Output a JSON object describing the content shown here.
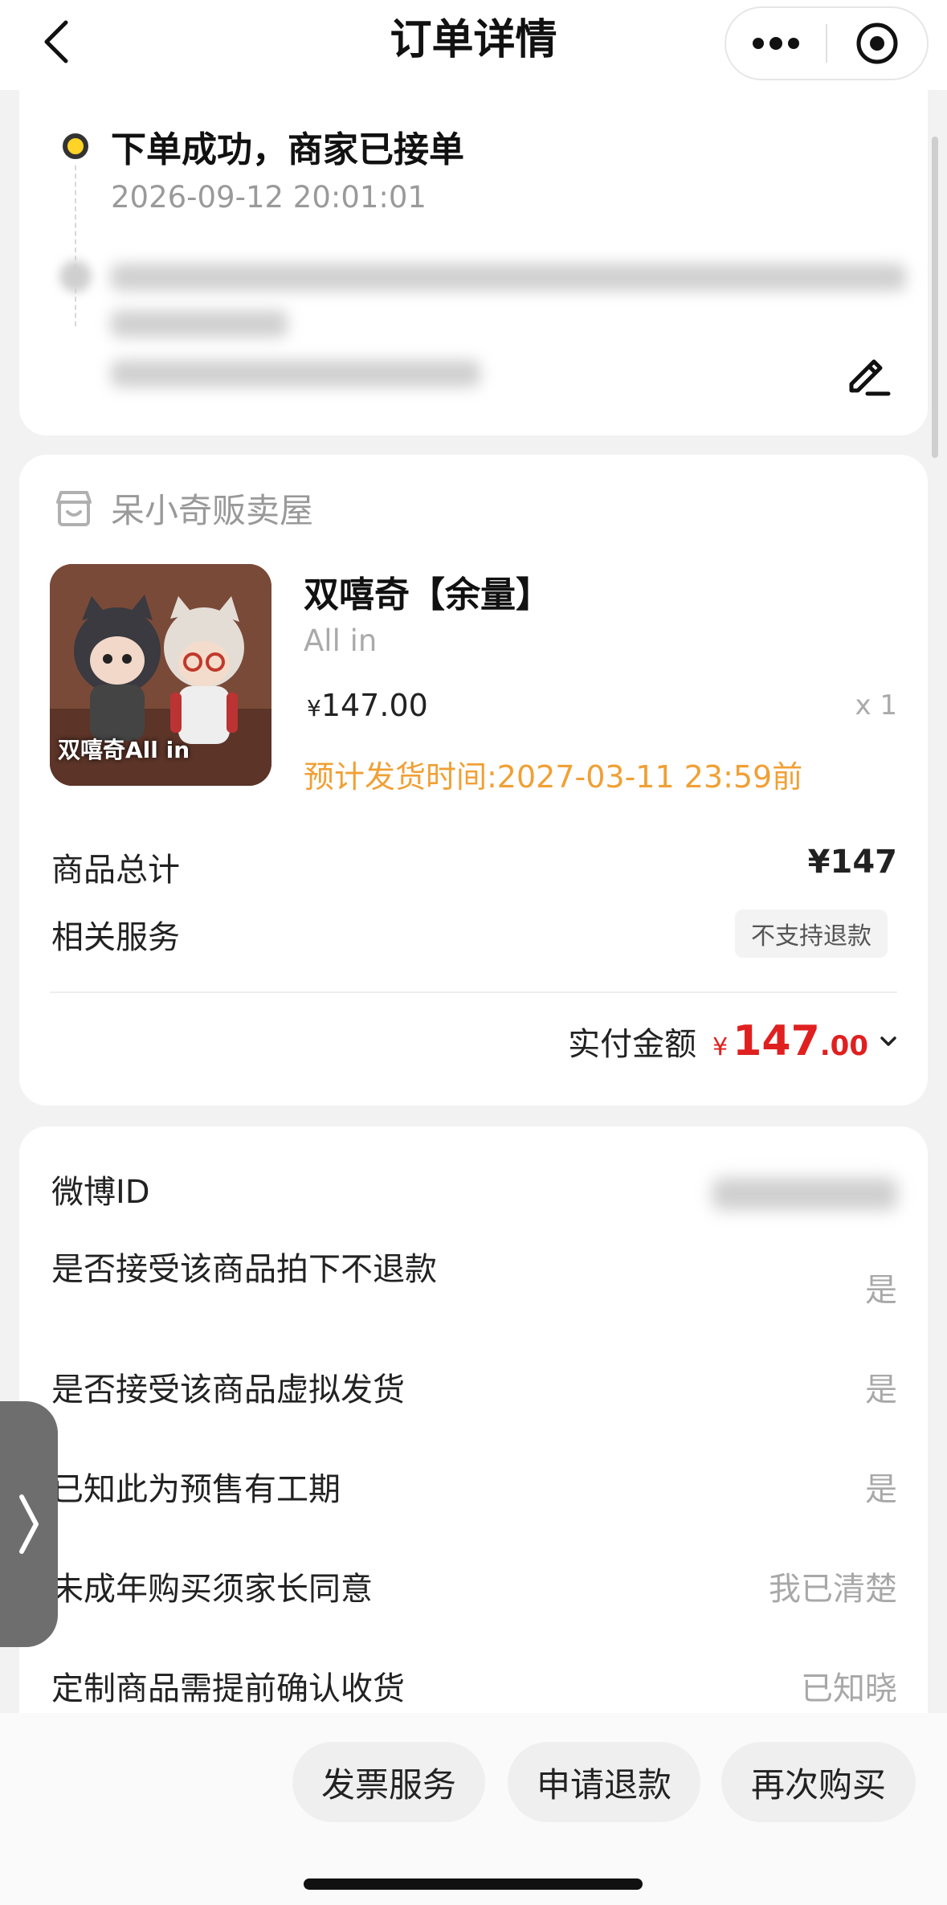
{
  "header": {
    "title": "订单详情"
  },
  "status": {
    "title": "下单成功，商家已接单",
    "time": "2026-09-12 20:01:01"
  },
  "shop": {
    "name": "呆小奇贩卖屋"
  },
  "product": {
    "title": "双嘻奇【余量】",
    "spec": "All in",
    "price_symbol": "¥",
    "price": "147.00",
    "qty": "x 1",
    "ship_time": "预计发货时间:2027-03-11 23:59前",
    "image_caption": "双嘻奇All in"
  },
  "summary": {
    "total_label": "商品总计",
    "total_value": "¥147",
    "service_label": "相关服务",
    "service_tag": "不支持退款",
    "paid_label": "实付金额",
    "paid_symbol": "¥",
    "paid_int": "147",
    "paid_dec": ".00"
  },
  "form": [
    {
      "label": "微博ID",
      "value": ""
    },
    {
      "label": "是否接受该商品拍下不退款",
      "value": "是"
    },
    {
      "label": "是否接受该商品虚拟发货",
      "value": "是"
    },
    {
      "label": "已知此为预售有工期",
      "value": "是"
    },
    {
      "label": "未成年购买须家长同意",
      "value": "我已清楚"
    },
    {
      "label": "定制商品需提前确认收货",
      "value": "已知晓"
    }
  ],
  "actions": {
    "invoice": "发票服务",
    "refund": "申请退款",
    "rebuy": "再次购买"
  },
  "colors": {
    "accent_red": "#e02020",
    "ship_orange": "#f0a035",
    "status_yellow": "#ffd426"
  }
}
